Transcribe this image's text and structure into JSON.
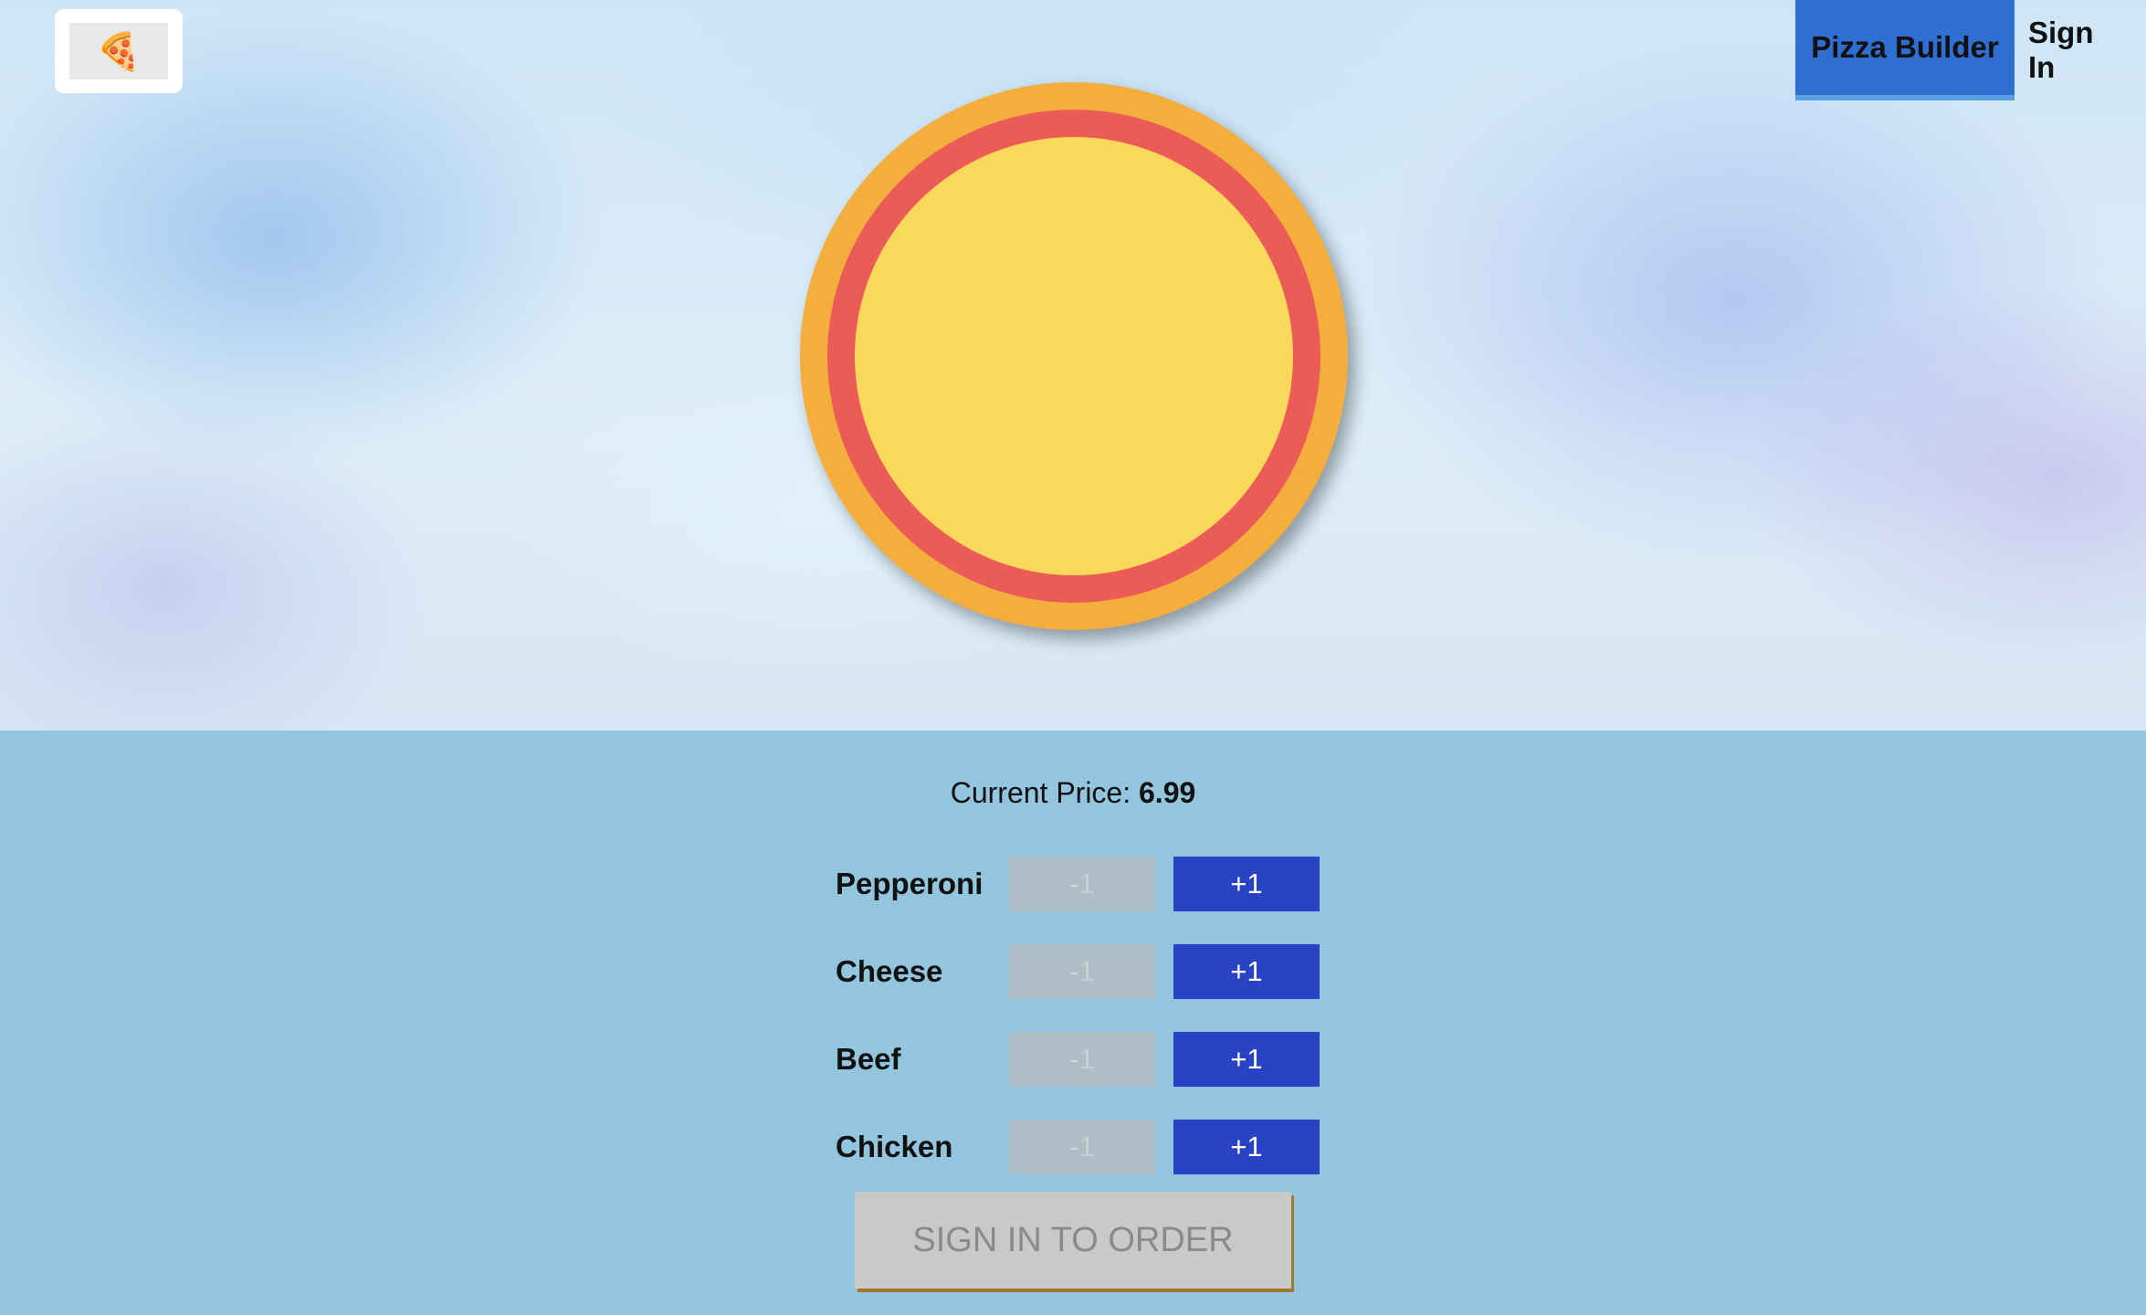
{
  "logo": {
    "icon": "pizza-slice-icon",
    "glyph": "🍕"
  },
  "nav": {
    "items": [
      {
        "label": "Pizza Builder",
        "active": true
      },
      {
        "label": "Sign In",
        "active": false
      }
    ]
  },
  "pizza": {
    "colors": {
      "crust": "#f3ae3e",
      "sauce": "#ec5c56",
      "cheese": "#f9d85c"
    }
  },
  "price": {
    "label": "Current Price:",
    "value": "6.99"
  },
  "ingredients": [
    {
      "name": "Pepperoni",
      "less_label": "-1",
      "more_label": "+1"
    },
    {
      "name": "Cheese",
      "less_label": "-1",
      "more_label": "+1"
    },
    {
      "name": "Beef",
      "less_label": "-1",
      "more_label": "+1"
    },
    {
      "name": "Chicken",
      "less_label": "-1",
      "more_label": "+1"
    }
  ],
  "order_button": {
    "label": "SIGN IN TO ORDER"
  },
  "colors": {
    "accent": "#2a43c4",
    "nav_active": "#2f6fd1",
    "panel": "#93c5de"
  }
}
